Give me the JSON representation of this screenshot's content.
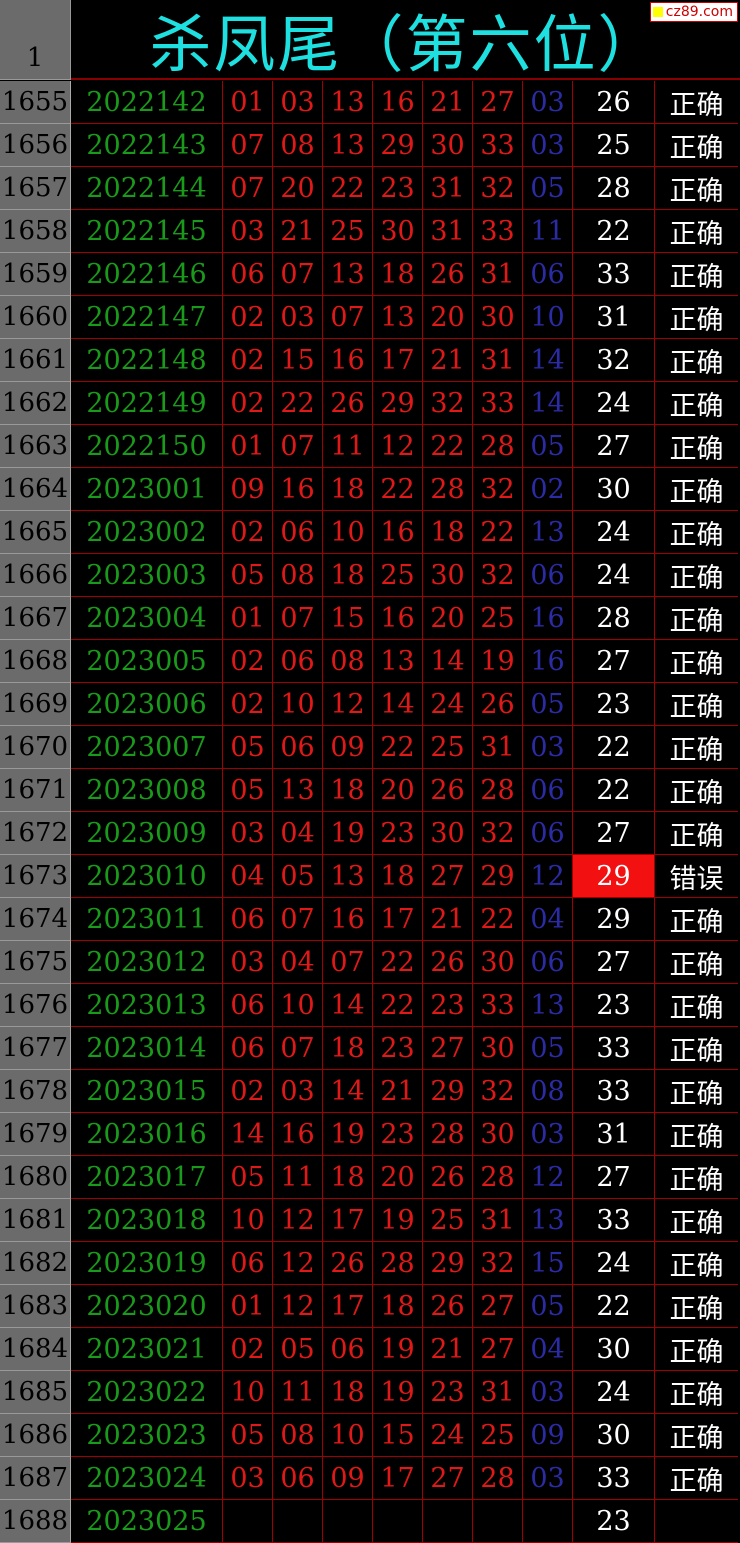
{
  "header": {
    "corner": "1",
    "title": "杀凤尾（第六位）",
    "logo": "cz89.com"
  },
  "rows": [
    {
      "n": "1655",
      "issue": "2022142",
      "reds": [
        "01",
        "03",
        "13",
        "16",
        "21",
        "27"
      ],
      "blue": "03",
      "total": "26",
      "result": "正确"
    },
    {
      "n": "1656",
      "issue": "2022143",
      "reds": [
        "07",
        "08",
        "13",
        "29",
        "30",
        "33"
      ],
      "blue": "03",
      "total": "25",
      "result": "正确"
    },
    {
      "n": "1657",
      "issue": "2022144",
      "reds": [
        "07",
        "20",
        "22",
        "23",
        "31",
        "32"
      ],
      "blue": "05",
      "total": "28",
      "result": "正确"
    },
    {
      "n": "1658",
      "issue": "2022145",
      "reds": [
        "03",
        "21",
        "25",
        "30",
        "31",
        "33"
      ],
      "blue": "11",
      "total": "22",
      "result": "正确"
    },
    {
      "n": "1659",
      "issue": "2022146",
      "reds": [
        "06",
        "07",
        "13",
        "18",
        "26",
        "31"
      ],
      "blue": "06",
      "total": "33",
      "result": "正确"
    },
    {
      "n": "1660",
      "issue": "2022147",
      "reds": [
        "02",
        "03",
        "07",
        "13",
        "20",
        "30"
      ],
      "blue": "10",
      "total": "31",
      "result": "正确"
    },
    {
      "n": "1661",
      "issue": "2022148",
      "reds": [
        "02",
        "15",
        "16",
        "17",
        "21",
        "31"
      ],
      "blue": "14",
      "total": "32",
      "result": "正确"
    },
    {
      "n": "1662",
      "issue": "2022149",
      "reds": [
        "02",
        "22",
        "26",
        "29",
        "32",
        "33"
      ],
      "blue": "14",
      "total": "24",
      "result": "正确"
    },
    {
      "n": "1663",
      "issue": "2022150",
      "reds": [
        "01",
        "07",
        "11",
        "12",
        "22",
        "28"
      ],
      "blue": "05",
      "total": "27",
      "result": "正确"
    },
    {
      "n": "1664",
      "issue": "2023001",
      "reds": [
        "09",
        "16",
        "18",
        "22",
        "28",
        "32"
      ],
      "blue": "02",
      "total": "30",
      "result": "正确"
    },
    {
      "n": "1665",
      "issue": "2023002",
      "reds": [
        "02",
        "06",
        "10",
        "16",
        "18",
        "22"
      ],
      "blue": "13",
      "total": "24",
      "result": "正确"
    },
    {
      "n": "1666",
      "issue": "2023003",
      "reds": [
        "05",
        "08",
        "18",
        "25",
        "30",
        "32"
      ],
      "blue": "06",
      "total": "24",
      "result": "正确"
    },
    {
      "n": "1667",
      "issue": "2023004",
      "reds": [
        "01",
        "07",
        "15",
        "16",
        "20",
        "25"
      ],
      "blue": "16",
      "total": "28",
      "result": "正确"
    },
    {
      "n": "1668",
      "issue": "2023005",
      "reds": [
        "02",
        "06",
        "08",
        "13",
        "14",
        "19"
      ],
      "blue": "16",
      "total": "27",
      "result": "正确"
    },
    {
      "n": "1669",
      "issue": "2023006",
      "reds": [
        "02",
        "10",
        "12",
        "14",
        "24",
        "26"
      ],
      "blue": "05",
      "total": "23",
      "result": "正确"
    },
    {
      "n": "1670",
      "issue": "2023007",
      "reds": [
        "05",
        "06",
        "09",
        "22",
        "25",
        "31"
      ],
      "blue": "03",
      "total": "22",
      "result": "正确"
    },
    {
      "n": "1671",
      "issue": "2023008",
      "reds": [
        "05",
        "13",
        "18",
        "20",
        "26",
        "28"
      ],
      "blue": "06",
      "total": "22",
      "result": "正确"
    },
    {
      "n": "1672",
      "issue": "2023009",
      "reds": [
        "03",
        "04",
        "19",
        "23",
        "30",
        "32"
      ],
      "blue": "06",
      "total": "27",
      "result": "正确"
    },
    {
      "n": "1673",
      "issue": "2023010",
      "reds": [
        "04",
        "05",
        "13",
        "18",
        "27",
        "29"
      ],
      "blue": "12",
      "total": "29",
      "result": "错误",
      "error": true
    },
    {
      "n": "1674",
      "issue": "2023011",
      "reds": [
        "06",
        "07",
        "16",
        "17",
        "21",
        "22"
      ],
      "blue": "04",
      "total": "29",
      "result": "正确"
    },
    {
      "n": "1675",
      "issue": "2023012",
      "reds": [
        "03",
        "04",
        "07",
        "22",
        "26",
        "30"
      ],
      "blue": "06",
      "total": "27",
      "result": "正确"
    },
    {
      "n": "1676",
      "issue": "2023013",
      "reds": [
        "06",
        "10",
        "14",
        "22",
        "23",
        "33"
      ],
      "blue": "13",
      "total": "23",
      "result": "正确"
    },
    {
      "n": "1677",
      "issue": "2023014",
      "reds": [
        "06",
        "07",
        "18",
        "23",
        "27",
        "30"
      ],
      "blue": "05",
      "total": "33",
      "result": "正确"
    },
    {
      "n": "1678",
      "issue": "2023015",
      "reds": [
        "02",
        "03",
        "14",
        "21",
        "29",
        "32"
      ],
      "blue": "08",
      "total": "33",
      "result": "正确"
    },
    {
      "n": "1679",
      "issue": "2023016",
      "reds": [
        "14",
        "16",
        "19",
        "23",
        "28",
        "30"
      ],
      "blue": "03",
      "total": "31",
      "result": "正确"
    },
    {
      "n": "1680",
      "issue": "2023017",
      "reds": [
        "05",
        "11",
        "18",
        "20",
        "26",
        "28"
      ],
      "blue": "12",
      "total": "27",
      "result": "正确"
    },
    {
      "n": "1681",
      "issue": "2023018",
      "reds": [
        "10",
        "12",
        "17",
        "19",
        "25",
        "31"
      ],
      "blue": "13",
      "total": "33",
      "result": "正确"
    },
    {
      "n": "1682",
      "issue": "2023019",
      "reds": [
        "06",
        "12",
        "26",
        "28",
        "29",
        "32"
      ],
      "blue": "15",
      "total": "24",
      "result": "正确"
    },
    {
      "n": "1683",
      "issue": "2023020",
      "reds": [
        "01",
        "12",
        "17",
        "18",
        "26",
        "27"
      ],
      "blue": "05",
      "total": "22",
      "result": "正确"
    },
    {
      "n": "1684",
      "issue": "2023021",
      "reds": [
        "02",
        "05",
        "06",
        "19",
        "21",
        "27"
      ],
      "blue": "04",
      "total": "30",
      "result": "正确"
    },
    {
      "n": "1685",
      "issue": "2023022",
      "reds": [
        "10",
        "11",
        "18",
        "19",
        "23",
        "31"
      ],
      "blue": "03",
      "total": "24",
      "result": "正确"
    },
    {
      "n": "1686",
      "issue": "2023023",
      "reds": [
        "05",
        "08",
        "10",
        "15",
        "24",
        "25"
      ],
      "blue": "09",
      "total": "30",
      "result": "正确"
    },
    {
      "n": "1687",
      "issue": "2023024",
      "reds": [
        "03",
        "06",
        "09",
        "17",
        "27",
        "28"
      ],
      "blue": "03",
      "total": "33",
      "result": "正确"
    },
    {
      "n": "1688",
      "issue": "2023025",
      "reds": [
        "",
        "",
        "",
        "",
        "",
        ""
      ],
      "blue": "",
      "total": "23",
      "result": ""
    }
  ]
}
